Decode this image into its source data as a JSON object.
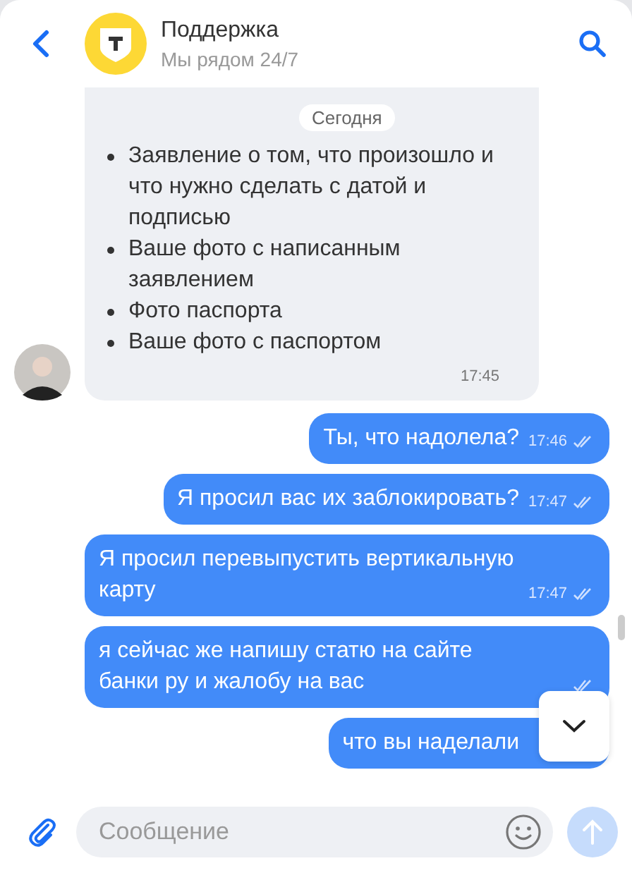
{
  "header": {
    "title": "Поддержка",
    "subtitle": "Мы рядом 24/7"
  },
  "date_chip": "Сегодня",
  "messages": [
    {
      "kind": "incoming",
      "items": [
        "Заявление о том, что произошло и что нужно сделать с датой и подписью",
        "Ваше фото с написанным заявлением",
        "Фото паспорта",
        "Ваше фото с паспортом"
      ],
      "time": "17:45"
    },
    {
      "kind": "outgoing",
      "text": "Ты, что надолела?",
      "time": "17:46",
      "read": true
    },
    {
      "kind": "outgoing",
      "text": "Я просил вас их заблокировать?",
      "time": "17:47",
      "read": true
    },
    {
      "kind": "outgoing",
      "text": "Я просил перевыпустить вертикальную карту",
      "time": "17:47",
      "read": true
    },
    {
      "kind": "outgoing",
      "text": "я сейчас же напишу статю на сайте банки ру и жалобу на вас",
      "read": true
    },
    {
      "kind": "outgoing",
      "text": "что вы наделали"
    }
  ],
  "composer": {
    "placeholder": "Сообщение"
  }
}
